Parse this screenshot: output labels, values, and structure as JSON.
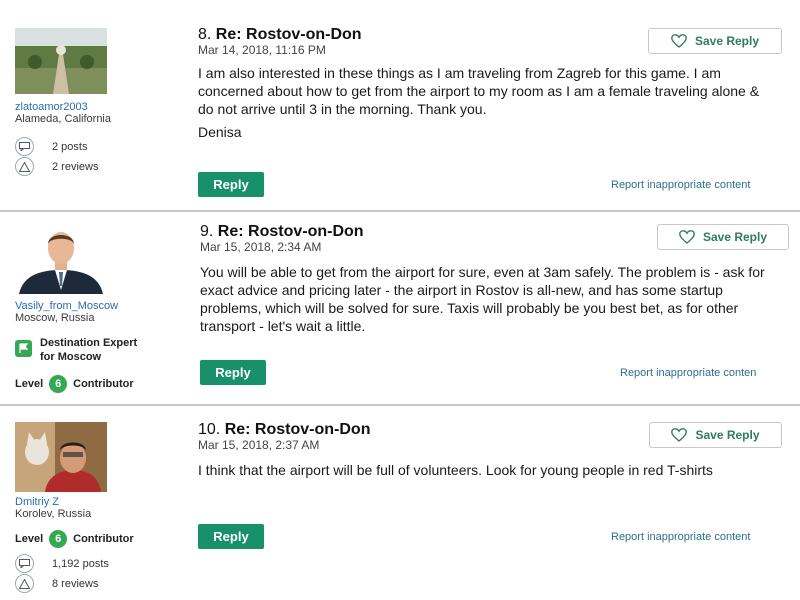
{
  "posts": [
    {
      "number": "8.",
      "title": "Re: Rostov-on-Don",
      "date": "Mar 14, 2018, 11:16 PM",
      "body": "I am also interested in these things as I am traveling from Zagreb for this game. I am concerned about how to get from the airport to my room as I am a female traveling alone & do not arrive until 3 in the morning. Thank you.",
      "signature": "Denisa",
      "save_label": "Save Reply",
      "reply_label": "Reply",
      "report_label": "Report inappropriate content",
      "user": {
        "name": "zlatoamor2003",
        "location": "Alameda, California",
        "posts": "2 posts",
        "reviews": "2 reviews"
      }
    },
    {
      "number": "9.",
      "title": "Re: Rostov-on-Don",
      "date": "Mar 15, 2018, 2:34 AM",
      "body": "You will be able to get from the airport for sure, even at 3am safely. The problem is - ask for exact advice and pricing later - the airport in Rostov is all-new, and has some startup problems, which will be solved for sure. Taxis will probably be you best bet, as for other transport - let's wait a little.",
      "save_label": "Save Reply",
      "reply_label": "Reply",
      "report_label": "Report inappropriate conten",
      "user": {
        "name": "Vasily_from_Moscow",
        "location": "Moscow, Russia",
        "dest_line1": "Destination Expert",
        "dest_line2": "for Moscow",
        "level_label": "Level",
        "level": "6",
        "level_suffix": "Contributor"
      }
    },
    {
      "number": "10.",
      "title": "Re: Rostov-on-Don",
      "date": "Mar 15, 2018, 2:37 AM",
      "body": "I think that the airport will be full of volunteers. Look for young people in red T-shirts",
      "save_label": "Save Reply",
      "reply_label": "Reply",
      "report_label": "Report inappropriate content",
      "user": {
        "name": "Dmitriy Z",
        "location": "Korolev, Russia",
        "level_label": "Level",
        "level": "6",
        "level_suffix": "Contributor",
        "posts": "1,192 posts",
        "reviews": "8 reviews"
      }
    }
  ],
  "colors": {
    "accent": "#18906a",
    "link": "#2a6db0",
    "badge": "#34a853"
  },
  "icons": [
    "heart-icon",
    "speech-bubble-icon",
    "review-owl-icon",
    "destination-expert-icon"
  ]
}
